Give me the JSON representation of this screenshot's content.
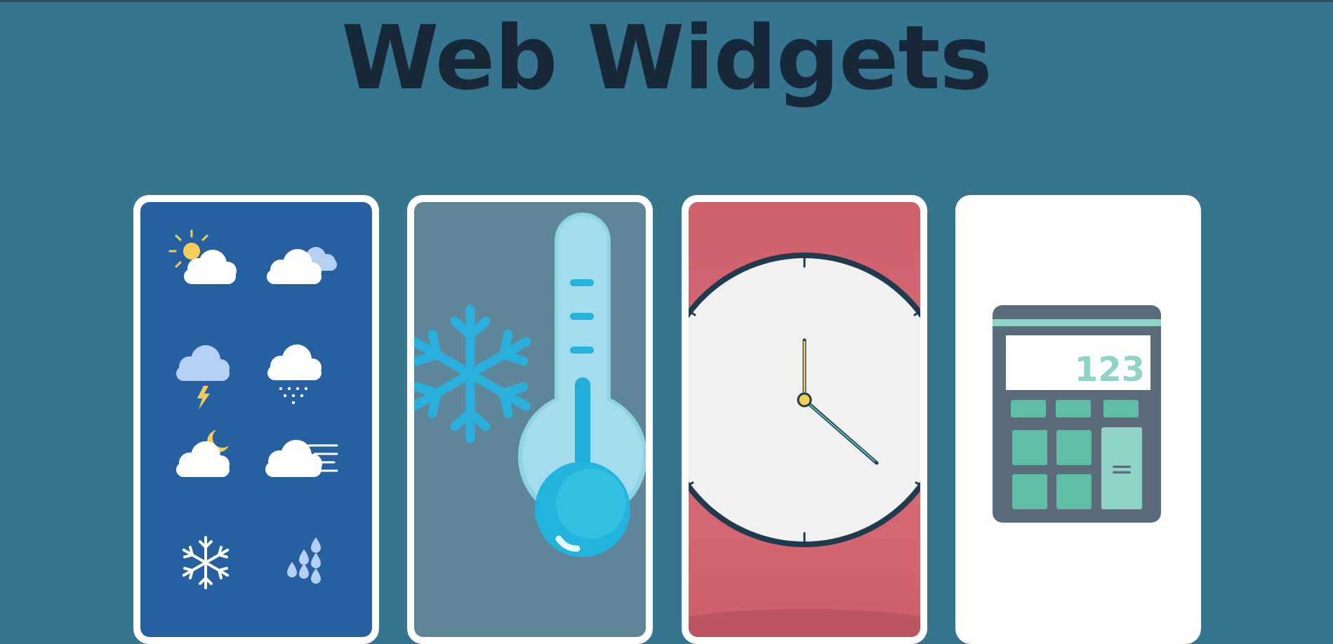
{
  "page": {
    "title": "Web Widgets"
  },
  "cards": [
    {
      "id": "weather",
      "icon": "weather-icons"
    },
    {
      "id": "temperature",
      "icon": "thermometer-icon"
    },
    {
      "id": "clock",
      "icon": "clock-icon"
    },
    {
      "id": "calculator",
      "icon": "calculator-icon",
      "display": "123",
      "equals": "="
    }
  ],
  "colors": {
    "background": "#37748d",
    "title": "#172838",
    "weather_card": "#2660a0",
    "temperature_card": "#5e8598",
    "clock_card": "#d66a76",
    "calculator_body": "#5a6b7b",
    "calculator_keys": "#5ebfa6"
  }
}
